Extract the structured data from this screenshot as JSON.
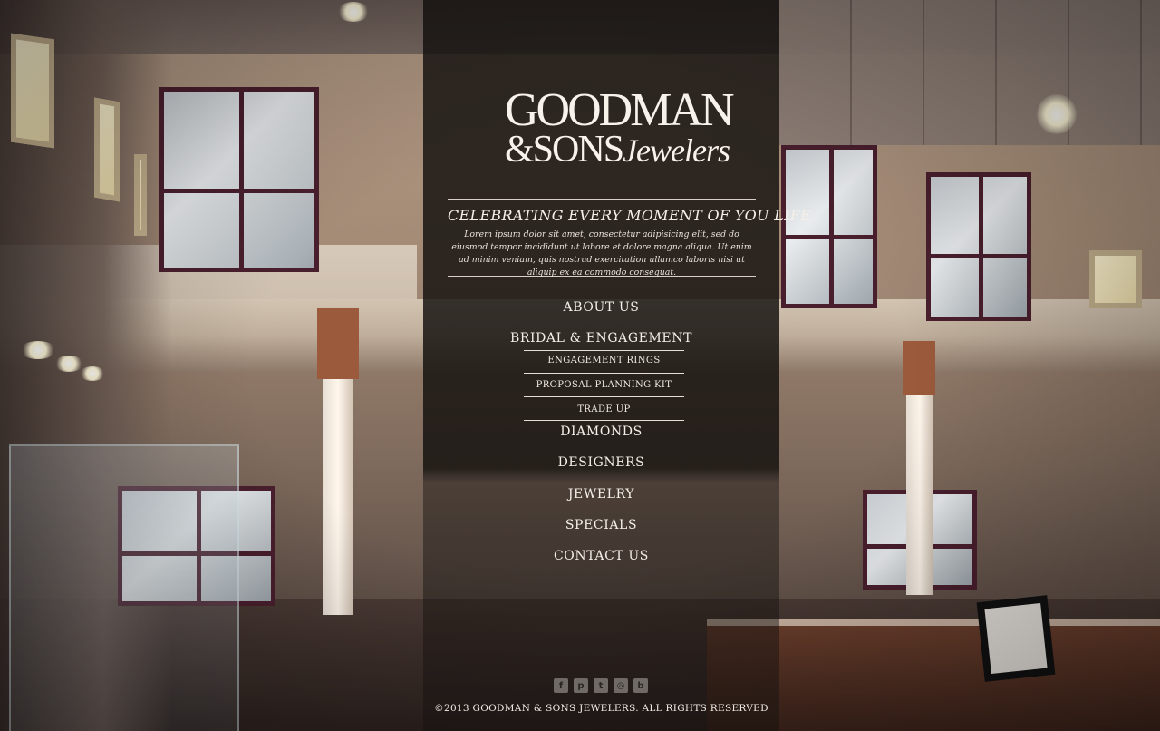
{
  "brand": {
    "logo_line1": "GOODMAN",
    "logo_line2_prefix": "&SONS",
    "logo_line2_script": "Jewelers"
  },
  "hero": {
    "tagline": "CELEBRATING EVERY MOMENT OF YOU LIFE",
    "body": "Lorem ipsum dolor sit amet, consectetur adipisicing elit, sed do eiusmod tempor incididunt ut labore et dolore magna aliqua. Ut enim ad minim veniam, quis nostrud exercitation ullamco laboris nisi ut aliquip ex ea commodo consequat."
  },
  "nav": {
    "about": "ABOUT US",
    "bridal": "BRIDAL & ENGAGEMENT",
    "bridal_sub": [
      "ENGAGEMENT RINGS",
      "PROPOSAL PLANNING KIT",
      "TRADE UP"
    ],
    "diamonds": "DIAMONDS",
    "designers": "DESIGNERS",
    "jewelry": "JEWELRY",
    "specials": "SPECIALS",
    "contact": "CONTACT US"
  },
  "social": {
    "icons": [
      "facebook-icon",
      "pinterest-icon",
      "twitter-icon",
      "instagram-icon",
      "blogger-icon"
    ],
    "glyphs": [
      "f",
      "p",
      "t",
      "◎",
      "b"
    ]
  },
  "footer": {
    "copyright": "©2013 GOODMAN & SONS JEWELERS. ALL RIGHTS RESERVED"
  },
  "colors": {
    "panel": "#120f0d",
    "text": "#f4efe8",
    "divider": "#d8d0c6",
    "icon": "#6f6a66"
  }
}
